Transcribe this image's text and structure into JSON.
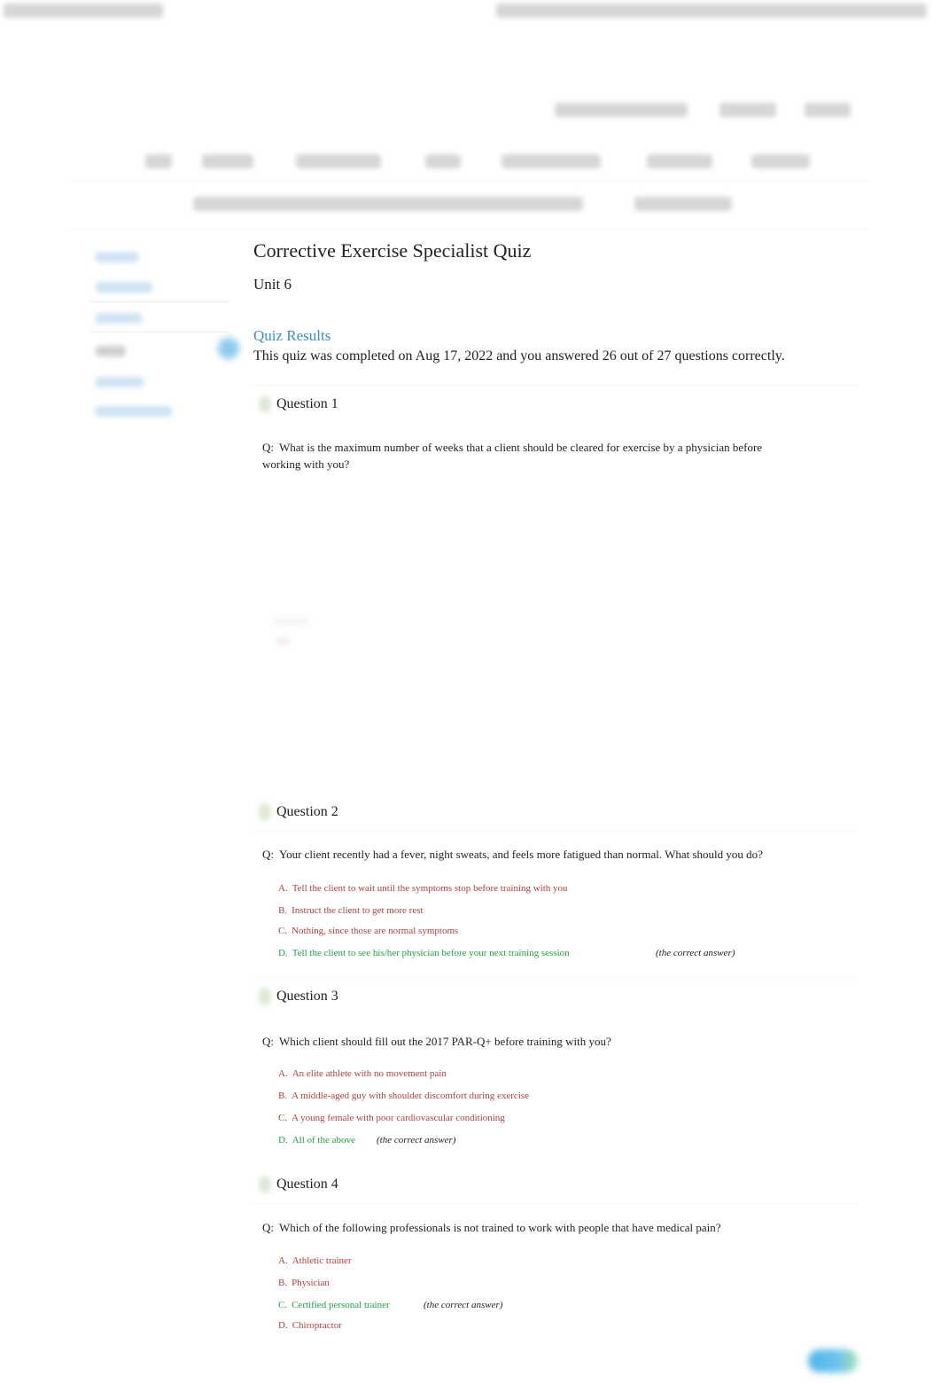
{
  "page": {
    "title": "Corrective Exercise Specialist Quiz",
    "unit": "Unit 6",
    "results_heading": "Quiz Results",
    "results_text": "This quiz was completed on Aug 17, 2022 and you answered 26 out of 27 questions correctly.",
    "score": {
      "correct": 26,
      "total": 27
    },
    "completed_date": "Aug 17, 2022"
  },
  "colors": {
    "accent": "#3b8fc7",
    "wrong_answer": "#b0423e",
    "correct_answer": "#23a04a"
  },
  "labels": {
    "question_prefix": "Q:",
    "correct_note": "(the correct answer)"
  },
  "questions": [
    {
      "label": "Question 1",
      "text": "What is the maximum number of weeks that a client should be cleared for exercise by a physician before working with you?",
      "answers": []
    },
    {
      "label": "Question 2",
      "text": "Your client recently had a fever, night sweats, and feels more fatigued than normal. What should you do?",
      "answers": [
        {
          "letter": "A.",
          "text": "Tell the client to wait until the symptoms stop before training with you",
          "correct": false
        },
        {
          "letter": "B.",
          "text": "Instruct the client to get more rest",
          "correct": false
        },
        {
          "letter": "C.",
          "text": "Nothing, since those are normal symptoms",
          "correct": false
        },
        {
          "letter": "D.",
          "text": "Tell the client to see his/her physician before your next training session",
          "correct": true
        }
      ]
    },
    {
      "label": "Question 3",
      "text": "Which client should fill out the 2017 PAR-Q+ before training with you?",
      "answers": [
        {
          "letter": "A.",
          "text": "An elite athlete with no movement pain",
          "correct": false
        },
        {
          "letter": "B.",
          "text": "A middle-aged guy with shoulder discomfort during exercise",
          "correct": false
        },
        {
          "letter": "C.",
          "text": "A young female with poor cardiovascular conditioning",
          "correct": false
        },
        {
          "letter": "D.",
          "text": "All of the above",
          "correct": true
        }
      ]
    },
    {
      "label": "Question 4",
      "text": "Which of the following professionals is not trained to work with people that have medical pain?",
      "answers": [
        {
          "letter": "A.",
          "text": "Athletic trainer",
          "correct": false
        },
        {
          "letter": "B.",
          "text": "Physician",
          "correct": false
        },
        {
          "letter": "C.",
          "text": "Certified personal trainer",
          "correct": true
        },
        {
          "letter": "D.",
          "text": "Chiropractor",
          "correct": false
        }
      ]
    }
  ],
  "icons": {
    "question_status": "check-badge-icon",
    "sidebar_active": "active-dot-icon",
    "floating_action": "chat-button-icon"
  }
}
